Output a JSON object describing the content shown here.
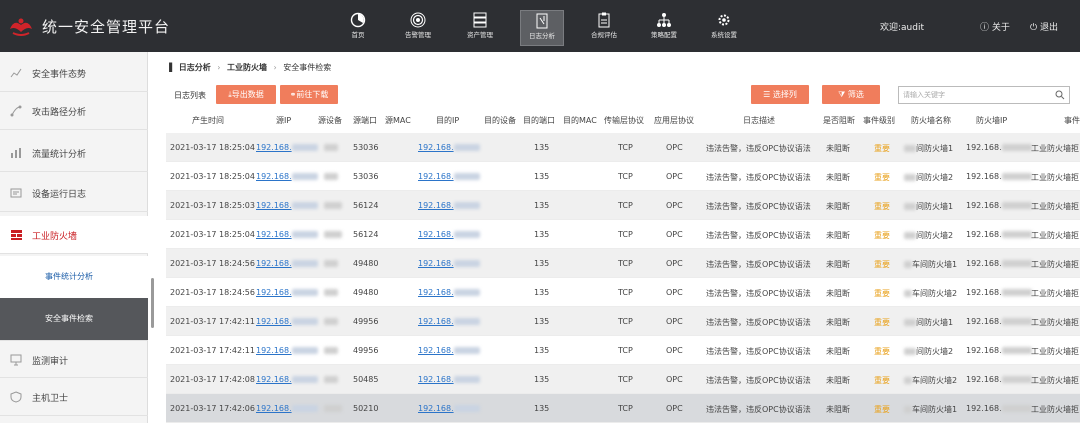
{
  "app": {
    "title": "统一安全管理平台",
    "welcome": "欢迎:audit",
    "about": "关于",
    "logout": "退出"
  },
  "nav": [
    {
      "label": "首页",
      "icon": "dashboard-icon"
    },
    {
      "label": "告警管理",
      "icon": "broadcast-icon"
    },
    {
      "label": "资产管理",
      "icon": "server-icon"
    },
    {
      "label": "日志分析",
      "icon": "log-analysis-icon",
      "active": true
    },
    {
      "label": "合规评估",
      "icon": "compliance-icon"
    },
    {
      "label": "策略配置",
      "icon": "org-chart-icon"
    },
    {
      "label": "系统设置",
      "icon": "gear-icon"
    }
  ],
  "sidebar": {
    "items": [
      {
        "label": "安全事件态势",
        "icon": "trend-icon"
      },
      {
        "label": "攻击路径分析",
        "icon": "path-icon"
      },
      {
        "label": "流量统计分析",
        "icon": "traffic-icon"
      },
      {
        "label": "设备运行日志",
        "icon": "device-log-icon"
      },
      {
        "label": "工业防火墙",
        "icon": "firewall-icon",
        "active": true
      }
    ],
    "subitems": [
      {
        "label": "事件统计分析"
      },
      {
        "label": "安全事件检索",
        "selected": true
      }
    ],
    "items_after": [
      {
        "label": "监测审计",
        "icon": "monitor-icon"
      },
      {
        "label": "主机卫士",
        "icon": "host-guard-icon"
      }
    ]
  },
  "breadcrumb": [
    "日志分析",
    "工业防火墙",
    "安全事件检索"
  ],
  "toolbar": {
    "list_label": "日志列表",
    "export": "导出数据",
    "goto_download": "前往下载",
    "select_columns": "选择列",
    "filter": "筛选",
    "search_placeholder": "请输入关键字"
  },
  "table": {
    "columns": [
      "产生时间",
      "源IP",
      "源设备",
      "源端口",
      "源MAC",
      "目的IP",
      "目的设备",
      "目的端口",
      "目的MAC",
      "传输层协议",
      "应用层协议",
      "日志描述",
      "是否阻断",
      "事件级别",
      "防火墙名称",
      "防火墙IP",
      "事件"
    ],
    "rows": [
      {
        "time": "2021-03-17 18:25:04",
        "src_ip": "192.168.",
        "src_port": "53036",
        "dst_ip": "192.168.",
        "dst_port": "135",
        "transport": "TCP",
        "app": "OPC",
        "desc": "违法告警，违反OPC协议语法",
        "blocked": "未阻断",
        "level": "重要",
        "fw_name": "间防火墙1",
        "fw_ip": "192.168.",
        "event": "工业防火墙拒"
      },
      {
        "time": "2021-03-17 18:25:04",
        "src_ip": "192.168.",
        "src_port": "53036",
        "dst_ip": "192.168.",
        "dst_port": "135",
        "transport": "TCP",
        "app": "OPC",
        "desc": "违法告警，违反OPC协议语法",
        "blocked": "未阻断",
        "level": "重要",
        "fw_name": "间防火墙2",
        "fw_ip": "192.168.",
        "event": "工业防火墙拒"
      },
      {
        "time": "2021-03-17 18:25:03",
        "src_ip": "192.168.",
        "src_port": "56124",
        "dst_ip": "192.168.",
        "dst_port": "135",
        "transport": "TCP",
        "app": "OPC",
        "desc": "违法告警，违反OPC协议语法",
        "blocked": "未阻断",
        "level": "重要",
        "fw_name": "间防火墙1",
        "fw_ip": "192.168.",
        "event": "工业防火墙拒"
      },
      {
        "time": "2021-03-17 18:25:04",
        "src_ip": "192.168.",
        "src_port": "56124",
        "dst_ip": "192.168.",
        "dst_port": "135",
        "transport": "TCP",
        "app": "OPC",
        "desc": "违法告警，违反OPC协议语法",
        "blocked": "未阻断",
        "level": "重要",
        "fw_name": "间防火墙2",
        "fw_ip": "192.168.",
        "event": "工业防火墙拒"
      },
      {
        "time": "2021-03-17 18:24:56",
        "src_ip": "192.168.",
        "src_port": "49480",
        "dst_ip": "192.168.",
        "dst_port": "135",
        "transport": "TCP",
        "app": "OPC",
        "desc": "违法告警，违反OPC协议语法",
        "blocked": "未阻断",
        "level": "重要",
        "fw_name": "车间防火墙1",
        "fw_ip": "192.168.",
        "event": "工业防火墙拒"
      },
      {
        "time": "2021-03-17 18:24:56",
        "src_ip": "192.168.",
        "src_port": "49480",
        "dst_ip": "192.168.",
        "dst_port": "135",
        "transport": "TCP",
        "app": "OPC",
        "desc": "违法告警，违反OPC协议语法",
        "blocked": "未阻断",
        "level": "重要",
        "fw_name": "车间防火墙2",
        "fw_ip": "192.168.",
        "event": "工业防火墙拒"
      },
      {
        "time": "2021-03-17 17:42:11",
        "src_ip": "192.168.",
        "src_port": "49956",
        "dst_ip": "192.168.",
        "dst_port": "135",
        "transport": "TCP",
        "app": "OPC",
        "desc": "违法告警，违反OPC协议语法",
        "blocked": "未阻断",
        "level": "重要",
        "fw_name": "间防火墙1",
        "fw_ip": "192.168.",
        "event": "工业防火墙拒"
      },
      {
        "time": "2021-03-17 17:42:11",
        "src_ip": "192.168.",
        "src_port": "49956",
        "dst_ip": "192.168.",
        "dst_port": "135",
        "transport": "TCP",
        "app": "OPC",
        "desc": "违法告警，违反OPC协议语法",
        "blocked": "未阻断",
        "level": "重要",
        "fw_name": "间防火墙2",
        "fw_ip": "192.168.",
        "event": "工业防火墙拒"
      },
      {
        "time": "2021-03-17 17:42:08",
        "src_ip": "192.168.",
        "src_port": "50485",
        "dst_ip": "192.168.",
        "dst_port": "135",
        "transport": "TCP",
        "app": "OPC",
        "desc": "违法告警，违反OPC协议语法",
        "blocked": "未阻断",
        "level": "重要",
        "fw_name": "车间防火墙2",
        "fw_ip": "192.168.",
        "event": "工业防火墙拒"
      },
      {
        "time": "2021-03-17 17:42:06",
        "src_ip": "192.168.",
        "src_port": "50210",
        "dst_ip": "192.168.",
        "dst_port": "135",
        "transport": "TCP",
        "app": "OPC",
        "desc": "违法告警，违反OPC协议语法",
        "blocked": "未阻断",
        "level": "重要",
        "fw_name": "车间防火墙1",
        "fw_ip": "192.168.",
        "event": "工业防火墙拒"
      }
    ]
  },
  "colors": {
    "topbar": "#2d2f33",
    "accent": "#f07d5c",
    "brand_red": "#c91d22",
    "link": "#2b74c9",
    "level": "#e9a21d"
  }
}
